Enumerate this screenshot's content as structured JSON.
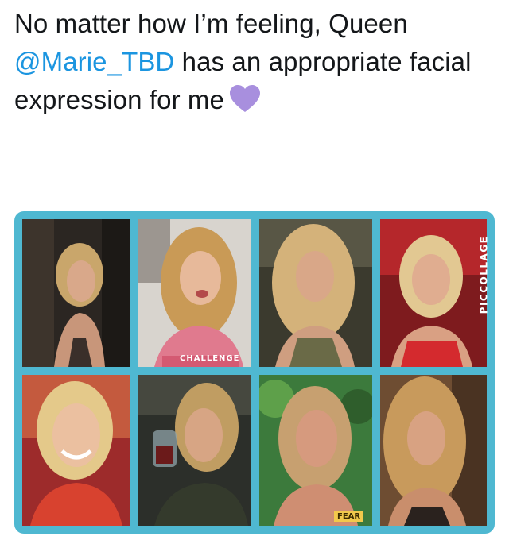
{
  "tweet": {
    "text_before": "No matter how I’m feeling, Queen ",
    "mention": "@Marie_TBD",
    "text_after": " has an appropriate facial expression for me",
    "heart_color": "#a88fde",
    "mention_color": "#1b95e0"
  },
  "collage": {
    "border_color": "#4fb8d1",
    "watermark": "PICCOLLAGE",
    "shirt_text": "CHALLENGE",
    "badge_text": "FEAR",
    "photos": [
      "photo-1",
      "photo-2",
      "photo-3",
      "photo-4",
      "photo-5",
      "photo-6",
      "photo-7",
      "photo-8"
    ]
  }
}
